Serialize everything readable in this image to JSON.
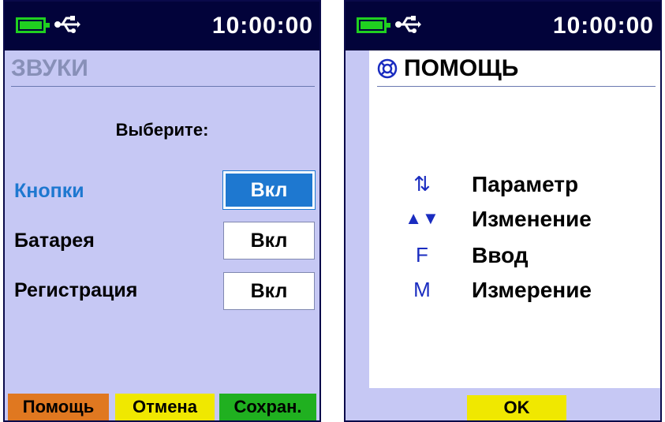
{
  "left_screen": {
    "status": {
      "time": "10:00:00",
      "battery_icon": "battery-icon",
      "usb_icon": "usb-icon"
    },
    "title": "ЗВУКИ",
    "prompt": "Выберите:",
    "rows": [
      {
        "label": "Кнопки",
        "value": "Вкл",
        "active": true
      },
      {
        "label": "Батарея",
        "value": "Вкл",
        "active": false
      },
      {
        "label": "Регистрация",
        "value": "Вкл",
        "active": false
      }
    ],
    "softkeys": [
      {
        "label": "Помощь",
        "color": "#e07820"
      },
      {
        "label": "Отмена",
        "color": "#f0e800"
      },
      {
        "label": "Сохран.",
        "color": "#20b020"
      }
    ]
  },
  "right_screen": {
    "status": {
      "time": "10:00:00",
      "battery_icon": "battery-icon",
      "usb_icon": "usb-icon"
    },
    "title": "ПОМОЩЬ",
    "title_icon": "lifebuoy-icon",
    "items": [
      {
        "key": "⇅",
        "text": "Параметр"
      },
      {
        "key": "▲▼",
        "text": "Изменение"
      },
      {
        "key": "F",
        "text": "Ввод"
      },
      {
        "key": "M",
        "text": "Измерение"
      }
    ],
    "ok_label": "OK"
  },
  "colors": {
    "status_bar": "#02033a",
    "screen_bg": "#c6c8f4",
    "accent_blue": "#1e78d0",
    "battery_green": "#20d020"
  }
}
